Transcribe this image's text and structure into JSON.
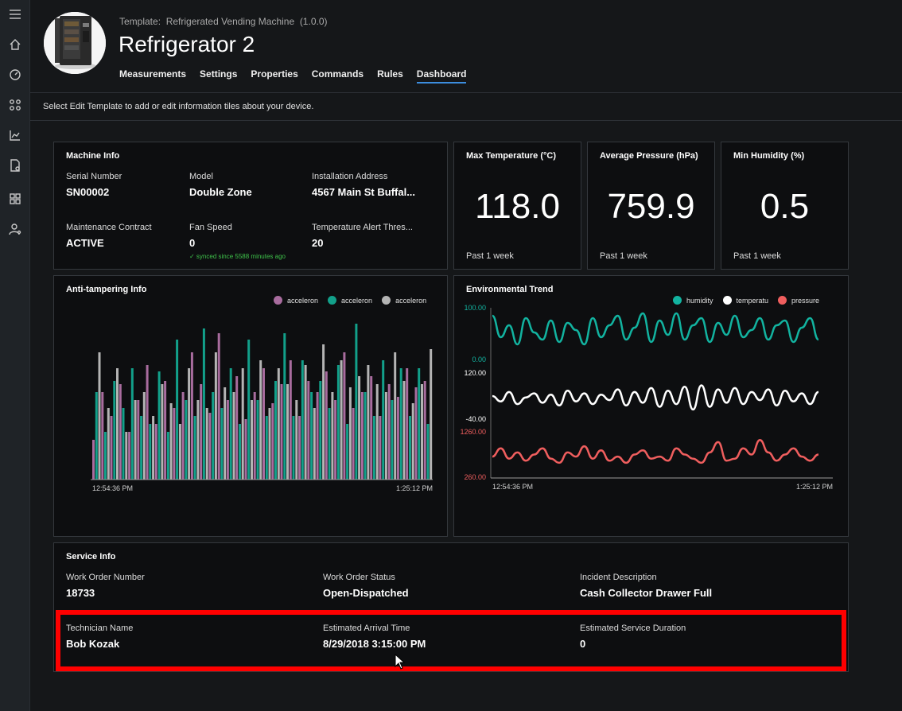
{
  "header": {
    "template_label": "Template:",
    "template_name": "Refrigerated Vending Machine",
    "template_version": "(1.0.0)",
    "device_name": "Refrigerator 2",
    "tabs": [
      "Measurements",
      "Settings",
      "Properties",
      "Commands",
      "Rules",
      "Dashboard"
    ],
    "active_tab": "Dashboard"
  },
  "nav": {
    "icons": [
      "menu-icon",
      "home-icon",
      "dashboard-gauge-icon",
      "device-explorer-icon",
      "analytics-icon",
      "jobs-icon",
      "templates-icon",
      "administration-icon"
    ]
  },
  "info_bar": {
    "message": "Select Edit Template to add or edit information tiles about your device."
  },
  "machine_info": {
    "title": "Machine Info",
    "fields": [
      {
        "label": "Serial Number",
        "value": "SN00002"
      },
      {
        "label": "Model",
        "value": "Double Zone"
      },
      {
        "label": "Installation Address",
        "value": "4567 Main St Buffal..."
      },
      {
        "label": "Maintenance Contract",
        "value": "ACTIVE"
      },
      {
        "label": "Fan Speed",
        "value": "0"
      },
      {
        "label": "Temperature Alert Thres...",
        "value": "20"
      }
    ],
    "synced_note": "✓ synced since 5588 minutes ago"
  },
  "kpis": [
    {
      "title": "Max Temperature (°C)",
      "value": "118.0",
      "period": "Past 1 week"
    },
    {
      "title": "Average Pressure (hPa)",
      "value": "759.9",
      "period": "Past 1 week"
    },
    {
      "title": "Min Humidity (%)",
      "value": "0.5",
      "period": "Past 1 week"
    }
  ],
  "anti_tampering": {
    "title": "Anti-tampering Info",
    "legend": [
      {
        "name": "acceleron",
        "color": "#a86c9e"
      },
      {
        "name": "acceleron",
        "color": "#12a08a"
      },
      {
        "name": "acceleron",
        "color": "#b4b4b4"
      }
    ],
    "x_start": "12:54:36 PM",
    "x_end": "1:25:12 PM"
  },
  "env_trend": {
    "title": "Environmental Trend",
    "legend": [
      {
        "name": "humidity",
        "color": "#12b3a0"
      },
      {
        "name": "temperatu",
        "color": "#ffffff"
      },
      {
        "name": "pressure",
        "color": "#ef5e5e"
      }
    ],
    "x_start": "12:54:36 PM",
    "x_end": "1:25:12 PM",
    "humidity_axis": [
      "100.00",
      "0.00"
    ],
    "temperature_axis": [
      "120.00",
      "-40.00"
    ],
    "pressure_axis": [
      "1260.00",
      "260.00"
    ]
  },
  "service_info": {
    "title": "Service Info",
    "fields": [
      {
        "label": "Work Order Number",
        "value": "18733"
      },
      {
        "label": "Work Order Status",
        "value": "Open-Dispatched"
      },
      {
        "label": "Incident Description",
        "value": "Cash Collector Drawer Full"
      },
      {
        "label": "Technician Name",
        "value": "Bob Kozak"
      },
      {
        "label": "Estimated Arrival Time",
        "value": "8/29/2018 3:15:00 PM"
      },
      {
        "label": "Estimated Service Duration",
        "value": "0"
      }
    ]
  },
  "chart_data": [
    {
      "type": "bar",
      "title": "Anti-tampering Info",
      "series": [
        {
          "name": "acceleron",
          "values": [
            0.25,
            0.55,
            0.4,
            0.6,
            0.3,
            0.5,
            0.72,
            0.35,
            0.62,
            0.45,
            0.55,
            0.8,
            0.6,
            0.42,
            0.92,
            0.5,
            0.65,
            0.38,
            0.55,
            0.7,
            0.48,
            0.6,
            0.75,
            0.4,
            0.62,
            0.55,
            0.68,
            0.5,
            0.8,
            0.45,
            0.55,
            0.65,
            0.4,
            0.6,
            0.52,
            0.7,
            0.58,
            0.62
          ]
        },
        {
          "name": "acceleron",
          "values": [
            0.55,
            0.3,
            0.62,
            0.45,
            0.7,
            0.4,
            0.35,
            0.68,
            0.3,
            0.88,
            0.5,
            0.4,
            0.95,
            0.55,
            0.45,
            0.7,
            0.35,
            0.88,
            0.5,
            0.4,
            0.62,
            0.92,
            0.4,
            0.75,
            0.55,
            0.62,
            0.45,
            0.72,
            0.35,
            0.98,
            0.55,
            0.4,
            0.75,
            0.5,
            0.7,
            0.4,
            0.7,
            0.35
          ]
        },
        {
          "name": "acceleron",
          "values": [
            0.8,
            0.45,
            0.7,
            0.3,
            0.5,
            0.55,
            0.4,
            0.6,
            0.48,
            0.35,
            0.7,
            0.5,
            0.45,
            0.8,
            0.58,
            0.55,
            0.7,
            0.5,
            0.75,
            0.45,
            0.7,
            0.6,
            0.5,
            0.72,
            0.45,
            0.85,
            0.55,
            0.75,
            0.58,
            0.65,
            0.72,
            0.6,
            0.55,
            0.8,
            0.62,
            0.48,
            0.6,
            0.82
          ]
        }
      ]
    },
    {
      "type": "line",
      "title": "Environmental Trend",
      "series": [
        {
          "name": "humidity",
          "ylim": [
            0,
            100
          ],
          "values": [
            90,
            45,
            70,
            30,
            85,
            55,
            40,
            80,
            35,
            75,
            60,
            30,
            85,
            45,
            70,
            90,
            40,
            65,
            95,
            35,
            80,
            50,
            95,
            40,
            70,
            85,
            35,
            75,
            50,
            90,
            45,
            60,
            85,
            40,
            70,
            80,
            35,
            65,
            85,
            40
          ]
        },
        {
          "name": "temperatu",
          "ylim": [
            -40,
            120
          ],
          "values": [
            40,
            20,
            55,
            10,
            35,
            50,
            15,
            45,
            5,
            60,
            20,
            50,
            10,
            45,
            25,
            65,
            5,
            55,
            15,
            70,
            0,
            60,
            10,
            75,
            -10,
            80,
            0,
            65,
            15,
            70,
            10,
            55,
            25,
            65,
            5,
            60,
            20,
            50,
            10,
            55
          ]
        },
        {
          "name": "pressure",
          "ylim": [
            260,
            1260
          ],
          "values": [
            700,
            900,
            650,
            800,
            600,
            750,
            900,
            650,
            550,
            800,
            700,
            950,
            650,
            850,
            600,
            700,
            550,
            750,
            850,
            650,
            700,
            600,
            900,
            750,
            650,
            550,
            800,
            1050,
            600,
            650,
            900,
            750,
            1100,
            800,
            600,
            750,
            900,
            700,
            600,
            750
          ]
        }
      ]
    }
  ]
}
